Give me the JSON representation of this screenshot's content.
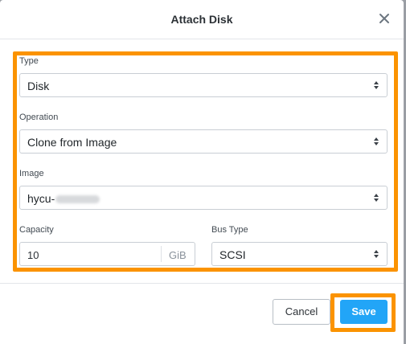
{
  "dialog": {
    "title": "Attach Disk"
  },
  "form": {
    "type_label": "Type",
    "type_value": "Disk",
    "operation_label": "Operation",
    "operation_value": "Clone from Image",
    "image_label": "Image",
    "image_value_prefix": "hycu-",
    "capacity_label": "Capacity",
    "capacity_value": "10",
    "capacity_unit": "GiB",
    "bus_type_label": "Bus Type",
    "bus_type_value": "SCSI"
  },
  "footer": {
    "cancel_label": "Cancel",
    "save_label": "Save"
  },
  "colors": {
    "highlight": "#fb9300",
    "primary": "#22a5f7",
    "overlay": "#9a9ea4"
  },
  "icons": {
    "close": "close-icon",
    "select_arrows": "select-arrows-icon"
  }
}
